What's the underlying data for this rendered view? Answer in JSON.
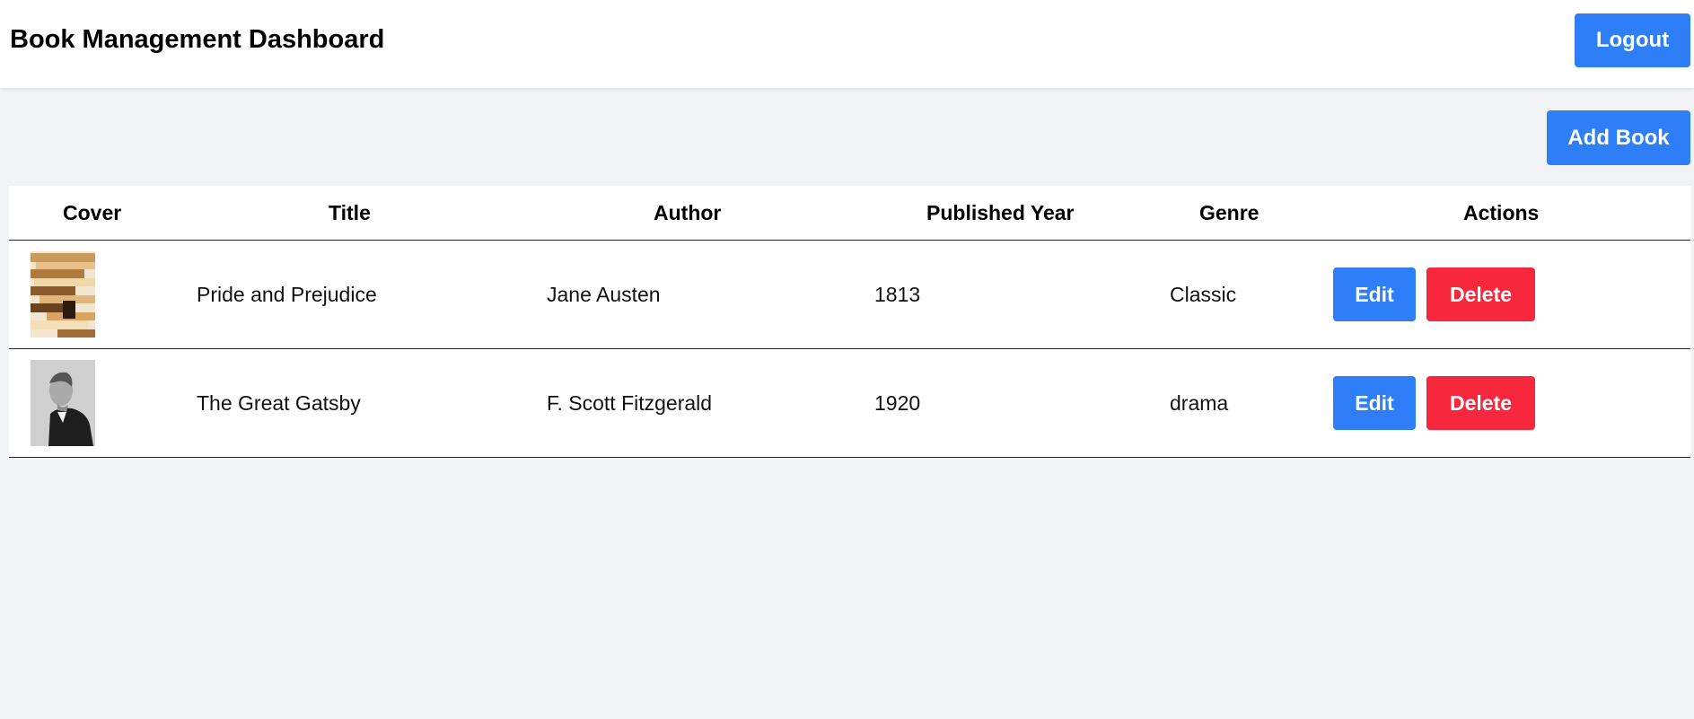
{
  "header": {
    "title": "Book Management Dashboard",
    "logout_label": "Logout"
  },
  "toolbar": {
    "add_book_label": "Add Book"
  },
  "table": {
    "columns": [
      "Cover",
      "Title",
      "Author",
      "Published Year",
      "Genre",
      "Actions"
    ],
    "rows": [
      {
        "cover": "stacked-books-image",
        "title": "Pride and Prejudice",
        "author": "Jane Austen",
        "year": "1813",
        "genre": "Classic",
        "edit_label": "Edit",
        "delete_label": "Delete"
      },
      {
        "cover": "portrait-photo-image",
        "title": "The Great Gatsby",
        "author": "F. Scott Fitzgerald",
        "year": "1920",
        "genre": "drama",
        "edit_label": "Edit",
        "delete_label": "Delete"
      }
    ]
  },
  "colors": {
    "primary": "#2e7ff7",
    "danger": "#f7273d",
    "background": "#f2f3f5"
  }
}
